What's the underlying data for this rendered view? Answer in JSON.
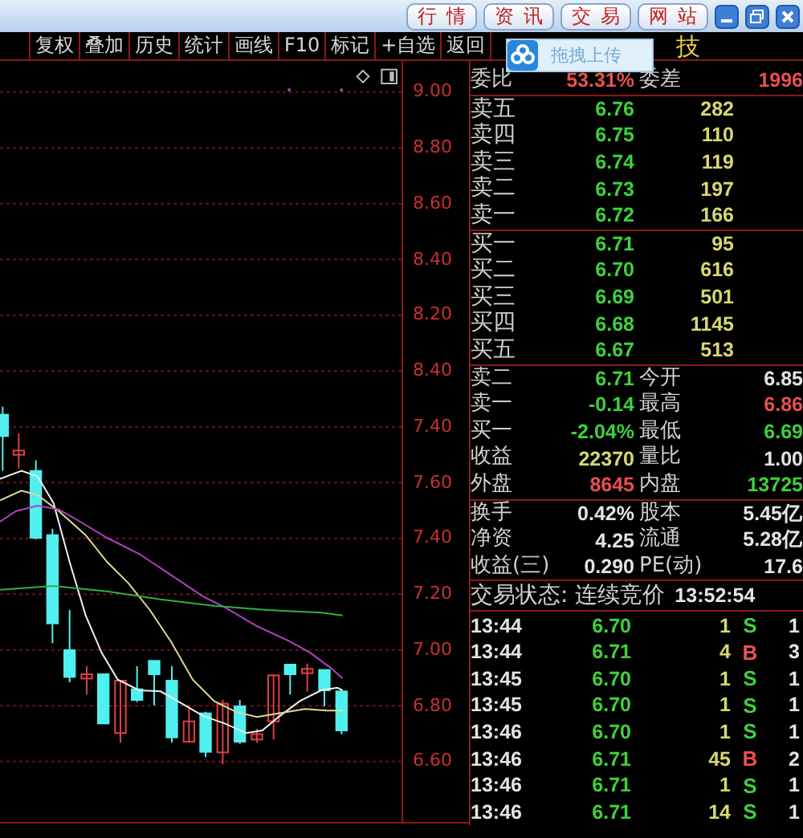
{
  "title_bar": {
    "buttons": [
      "行情",
      "资讯",
      "交易",
      "网站"
    ]
  },
  "toolbar": {
    "items": [
      "复权",
      "叠加",
      "历史",
      "统计",
      "画线",
      "F10",
      "标记",
      "+自选",
      "返回"
    ]
  },
  "stock_name": "技",
  "upload_popup": {
    "label": "拖拽上传"
  },
  "chart": {
    "price_labels": [
      "9.00",
      "8.80",
      "8.60",
      "8.40",
      "8.20",
      "8.40",
      "7.40",
      "7.60",
      "7.40",
      "7.20",
      "7.00",
      "6.80",
      "6.60"
    ]
  },
  "quote": {
    "ratio_row": [
      {
        "label": "委比",
        "value": "53.31%",
        "color": "#e85050"
      },
      {
        "label": "委差",
        "value": "1996",
        "color": "#e85050"
      }
    ],
    "asks": [
      {
        "label": "卖五",
        "price": "6.76",
        "volume": "282"
      },
      {
        "label": "卖四",
        "price": "6.75",
        "volume": "110"
      },
      {
        "label": "卖三",
        "price": "6.74",
        "volume": "119"
      },
      {
        "label": "卖二",
        "price": "6.73",
        "volume": "197"
      },
      {
        "label": "卖一",
        "price": "6.72",
        "volume": "166"
      }
    ],
    "bids": [
      {
        "label": "买一",
        "price": "6.71",
        "volume": "95"
      },
      {
        "label": "买二",
        "price": "6.70",
        "volume": "616"
      },
      {
        "label": "买三",
        "price": "6.69",
        "volume": "501"
      },
      {
        "label": "买四",
        "price": "6.68",
        "volume": "1145"
      },
      {
        "label": "买五",
        "price": "6.67",
        "volume": "513"
      }
    ],
    "stats_1": [
      [
        {
          "label": "卖二",
          "value": "6.71",
          "color": "#3cd23c"
        },
        {
          "label": "今开",
          "value": "6.85",
          "color": "#e4e4e4"
        }
      ],
      [
        {
          "label": "卖一",
          "value": "-0.14",
          "color": "#3cd23c"
        },
        {
          "label": "最高",
          "value": "6.86",
          "color": "#e85050"
        }
      ],
      [
        {
          "label": "买一",
          "value": "-2.04%",
          "color": "#3cd23c"
        },
        {
          "label": "最低",
          "value": "6.69",
          "color": "#3cd23c"
        }
      ],
      [
        {
          "label": "收益",
          "value": "22370",
          "color": "#d8d870"
        },
        {
          "label": "量比",
          "value": "1.00",
          "color": "#e4e4e4"
        }
      ],
      [
        {
          "label": "外盘",
          "value": "8645",
          "color": "#e85050"
        },
        {
          "label": "内盘",
          "value": "13725",
          "color": "#3cd23c"
        }
      ]
    ],
    "stats_2": [
      [
        {
          "label": "换手",
          "value": "0.42%",
          "color": "#e4e4e4"
        },
        {
          "label": "股本",
          "value": "5.45亿",
          "color": "#e4e4e4"
        }
      ],
      [
        {
          "label": "净资",
          "value": "4.25",
          "color": "#e4e4e4"
        },
        {
          "label": "流通",
          "value": "5.28亿",
          "color": "#e4e4e4"
        }
      ],
      [
        {
          "label": "收益(三)",
          "value": "0.290",
          "color": "#e4e4e4"
        },
        {
          "label": "PE(动)",
          "value": "17.6",
          "color": "#e4e4e4"
        }
      ]
    ],
    "status": {
      "label": "交易状态: 连续竞价",
      "time": "13:52:54"
    },
    "trades": [
      {
        "time": "13:44",
        "price": "6.70",
        "volume": "1",
        "side": "S",
        "color": "#3cd23c",
        "count": "1"
      },
      {
        "time": "13:44",
        "price": "6.71",
        "volume": "4",
        "side": "B",
        "color": "#e85050",
        "count": "3"
      },
      {
        "time": "13:45",
        "price": "6.70",
        "volume": "1",
        "side": "S",
        "color": "#3cd23c",
        "count": "1"
      },
      {
        "time": "13:45",
        "price": "6.70",
        "volume": "1",
        "side": "S",
        "color": "#3cd23c",
        "count": "1"
      },
      {
        "time": "13:46",
        "price": "6.70",
        "volume": "1",
        "side": "S",
        "color": "#3cd23c",
        "count": "1"
      },
      {
        "time": "13:46",
        "price": "6.71",
        "volume": "45",
        "side": "B",
        "color": "#e85050",
        "count": "2"
      },
      {
        "time": "13:46",
        "price": "6.71",
        "volume": "1",
        "side": "S",
        "color": "#3cd23c",
        "count": "1"
      },
      {
        "time": "13:46",
        "price": "6.71",
        "volume": "14",
        "side": "S",
        "color": "#3cd23c",
        "count": "1"
      }
    ]
  }
}
